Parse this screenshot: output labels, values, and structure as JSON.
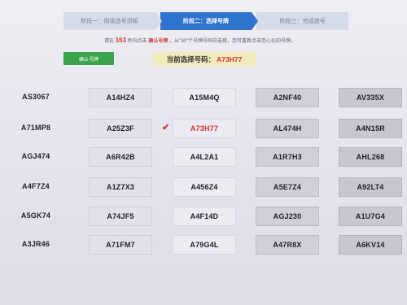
{
  "steps": [
    {
      "label": "阶段一：阅读选号须知",
      "active": false
    },
    {
      "label": "阶段二：选择号牌",
      "active": true
    },
    {
      "label": "阶段三：完成选号",
      "active": false
    }
  ],
  "notice": {
    "prefix": "请在",
    "count": "163",
    "middle": "秒内点击",
    "emphasis": "确认号牌",
    "suffix": "，从\"30\"个号牌号码中选择，您可重新点击您心仪的号牌。"
  },
  "confirm_label": "确认号牌",
  "current": {
    "label": "当前选择号码：",
    "value": "A73H77"
  },
  "plates": [
    [
      "AS3067",
      "A14HZ4",
      "A15M4Q",
      "A2NF40",
      "AV335X"
    ],
    [
      "A71MP8",
      "A25Z3F",
      "A73H77",
      "AL474H",
      "A4N15R"
    ],
    [
      "AGJ474",
      "A6R42B",
      "A4L2A1",
      "A1R7H3",
      "AHL268"
    ],
    [
      "A4F7Z4",
      "A1Z7X3",
      "A456Z4",
      "A5E7Z4",
      "A92LT4"
    ],
    [
      "A5GK74",
      "A74JF5",
      "A4F14D",
      "AGJ230",
      "A1U7G4"
    ],
    [
      "A3JR46",
      "A71FM7",
      "A79G4L",
      "A47R8X",
      "A6KV14"
    ]
  ],
  "selected_plate": "A73H77"
}
